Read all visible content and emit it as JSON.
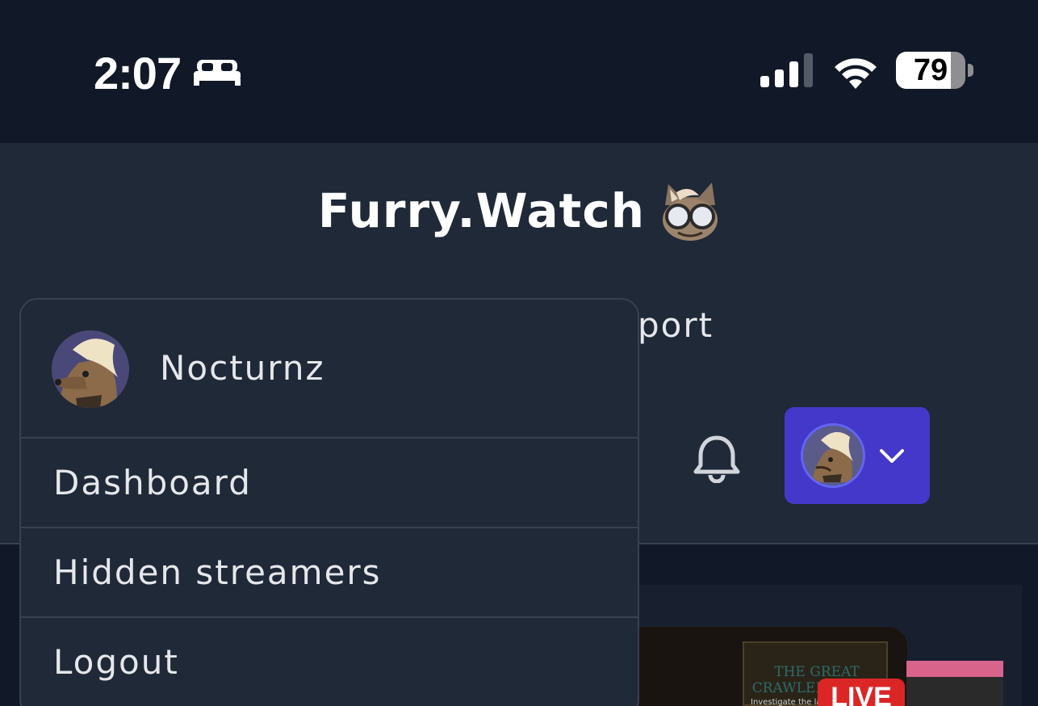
{
  "status_bar": {
    "time": "2:07",
    "focus_icon": "bed-icon",
    "signal_icon": "cellular-signal-icon",
    "wifi_icon": "wifi-icon",
    "battery_percent": "79",
    "battery_level": 0.79
  },
  "header": {
    "title": "Furry.Watch",
    "nav_partial": "port",
    "notification_icon": "bell-icon",
    "profile_chevron_icon": "chevron-down-icon",
    "accent_color": "#4338ca"
  },
  "dropdown": {
    "username": "Nocturnz",
    "items": [
      {
        "label": "Dashboard"
      },
      {
        "label": "Hidden streamers"
      },
      {
        "label": "Logout"
      }
    ]
  },
  "content": {
    "stream_thumbnail_title": "THE GREAT CRAWLER'S PATH",
    "stream_thumbnail_subtitle": "Investigate the la",
    "live_badge": "LIVE"
  }
}
